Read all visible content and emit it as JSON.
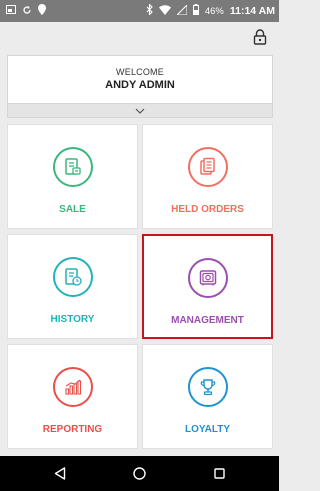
{
  "status_bar": {
    "left_icons": [
      "screenshot-icon",
      "sync-icon",
      "location-pin-icon"
    ],
    "right_icons": [
      "bluetooth-icon",
      "wifi-icon",
      "signal-icon",
      "battery-icon"
    ],
    "battery": "46%",
    "time": "11:14 AM"
  },
  "header": {
    "lock_icon": "lock-icon"
  },
  "welcome": {
    "greeting": "WELCOME",
    "user_name": "ANDY ADMIN",
    "expand_icon": "chevron-down-icon"
  },
  "tiles": [
    {
      "label": "SALE",
      "icon": "receipt-icon",
      "color": "#3bb77e"
    },
    {
      "label": "HELD ORDERS",
      "icon": "held-orders-icon",
      "color": "#f0705f"
    },
    {
      "label": "HISTORY",
      "icon": "history-icon",
      "color": "#22b3b9"
    },
    {
      "label": "MANAGEMENT",
      "icon": "safe-icon",
      "color": "#9b4fb0"
    },
    {
      "label": "REPORTING",
      "icon": "bar-chart-icon",
      "color": "#e8504a"
    },
    {
      "label": "LOYALTY",
      "icon": "trophy-icon",
      "color": "#1f92cf"
    }
  ],
  "selected_tile": "MANAGEMENT",
  "selection_color": "#c4161c",
  "nav_bar": {
    "back_icon": "back-triangle-icon",
    "home_icon": "home-circle-icon",
    "recents_icon": "recents-square-icon"
  }
}
